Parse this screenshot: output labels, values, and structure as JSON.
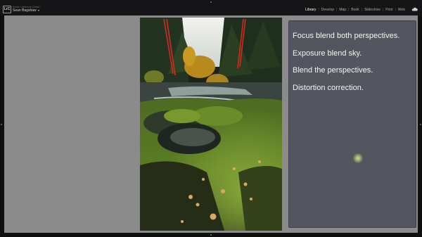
{
  "header": {
    "logo": "LrC",
    "app_name": "Adobe Lightroom Classic",
    "user": "Sean Bagshaw",
    "modules": [
      {
        "label": "Library",
        "active": true
      },
      {
        "label": "Develop",
        "active": false
      },
      {
        "label": "Map",
        "active": false
      },
      {
        "label": "Book",
        "active": false
      },
      {
        "label": "Slideshow",
        "active": false
      },
      {
        "label": "Print",
        "active": false
      },
      {
        "label": "Web",
        "active": false
      }
    ],
    "cloud_icon": "cloud-icon"
  },
  "notes": {
    "items": [
      "Focus blend both perspectives.",
      "Exposure blend sky.",
      "Blend the perspectives.",
      "Distortion correction."
    ]
  },
  "colors": {
    "topbar": "#151517",
    "canvas": "#8b8b8c",
    "notes_panel": "#54565f",
    "active_module": "#ffffff",
    "guide_lines": "#d42a1e"
  }
}
